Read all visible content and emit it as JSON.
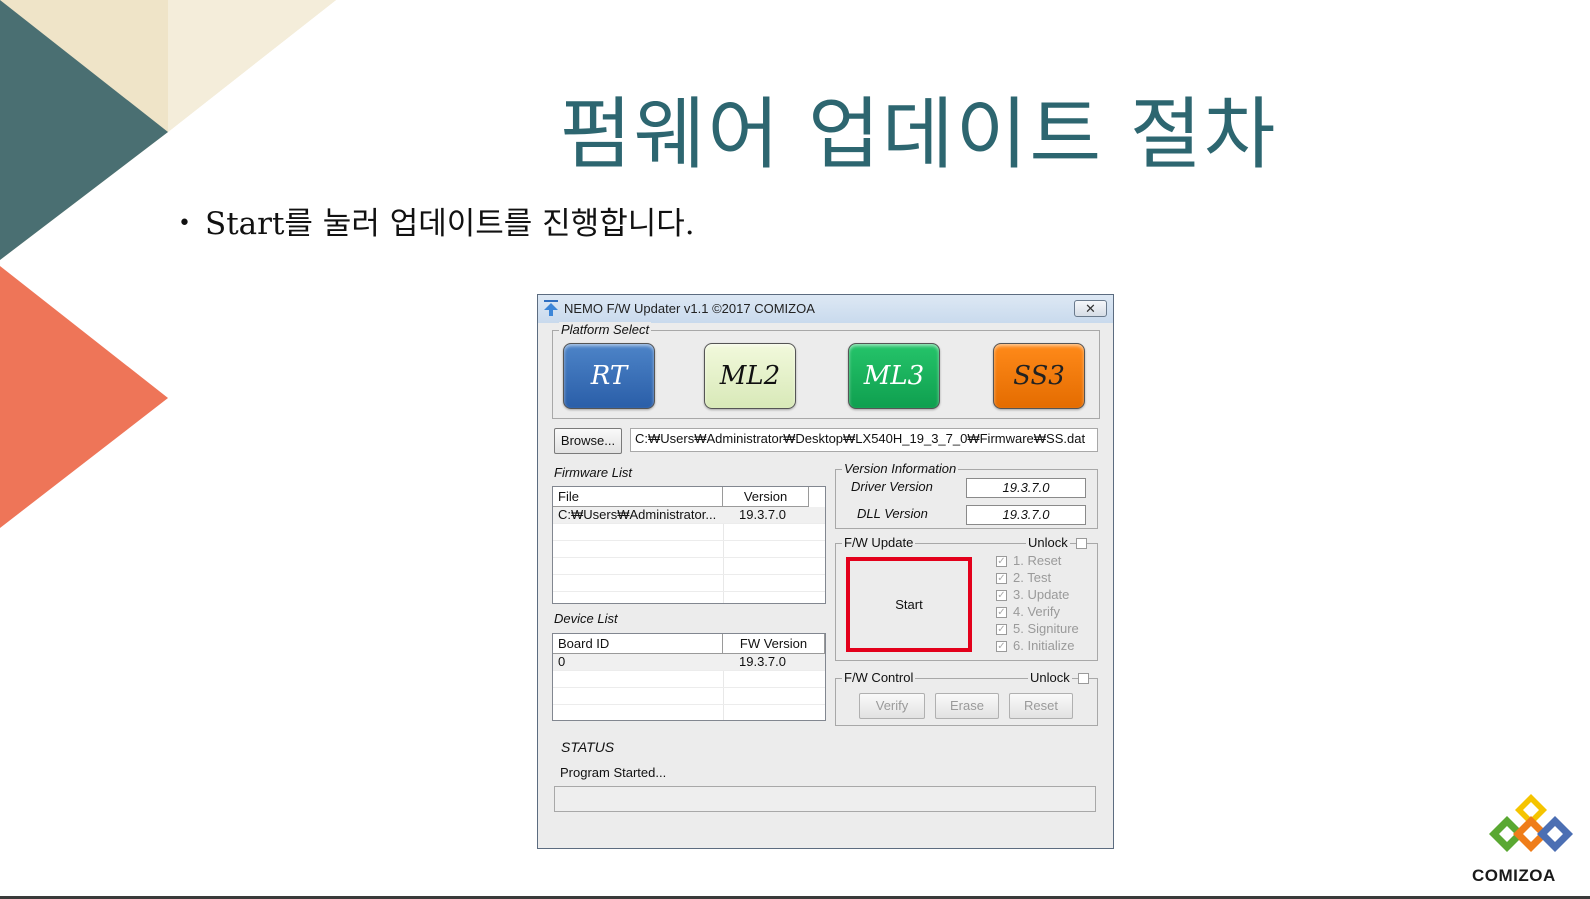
{
  "slide": {
    "title": "펌웨어 업데이트 절차",
    "bullet_marker": "•",
    "bullet": "Start를 눌러 업데이트를 진행합니다.",
    "logo_text": "COMIZOA",
    "colors": {
      "title": "#2d6670",
      "teal": "#4a6f72",
      "beige": "#efe4c8",
      "salmon": "#ee7558",
      "highlight": "#e3001b"
    }
  },
  "window": {
    "title": "NEMO F/W Updater v1.1 ©2017 COMIZOA",
    "close_glyph": "✕",
    "platform_select": {
      "label": "Platform Select",
      "buttons": [
        "RT",
        "ML2",
        "ML3",
        "SS3"
      ]
    },
    "browse": {
      "label": "Browse...",
      "path": "C:₩Users₩Administrator₩Desktop₩LX540H_19_3_7_0₩Firmware₩SS.dat"
    },
    "firmware_list": {
      "label": "Firmware List",
      "columns": [
        "File",
        "Version"
      ],
      "rows": [
        {
          "file": "C:₩Users₩Administrator...",
          "version": "19.3.7.0"
        }
      ]
    },
    "device_list": {
      "label": "Device List",
      "columns": [
        "Board ID",
        "FW Version"
      ],
      "rows": [
        {
          "board_id": "0",
          "fw_version": "19.3.7.0"
        }
      ]
    },
    "version_info": {
      "label": "Version Information",
      "driver_label": "Driver Version",
      "driver_value": "19.3.7.0",
      "dll_label": "DLL Version",
      "dll_value": "19.3.7.0"
    },
    "fw_update": {
      "label": "F/W Update",
      "unlock": "Unlock",
      "start": "Start",
      "steps": [
        "1. Reset",
        "2. Test",
        "3. Update",
        "4. Verify",
        "5. Signiture",
        "6. Initialize"
      ]
    },
    "fw_control": {
      "label": "F/W Control",
      "unlock": "Unlock",
      "buttons": [
        "Verify",
        "Erase",
        "Reset"
      ]
    },
    "status": {
      "label": "STATUS",
      "message": "Program Started..."
    }
  }
}
